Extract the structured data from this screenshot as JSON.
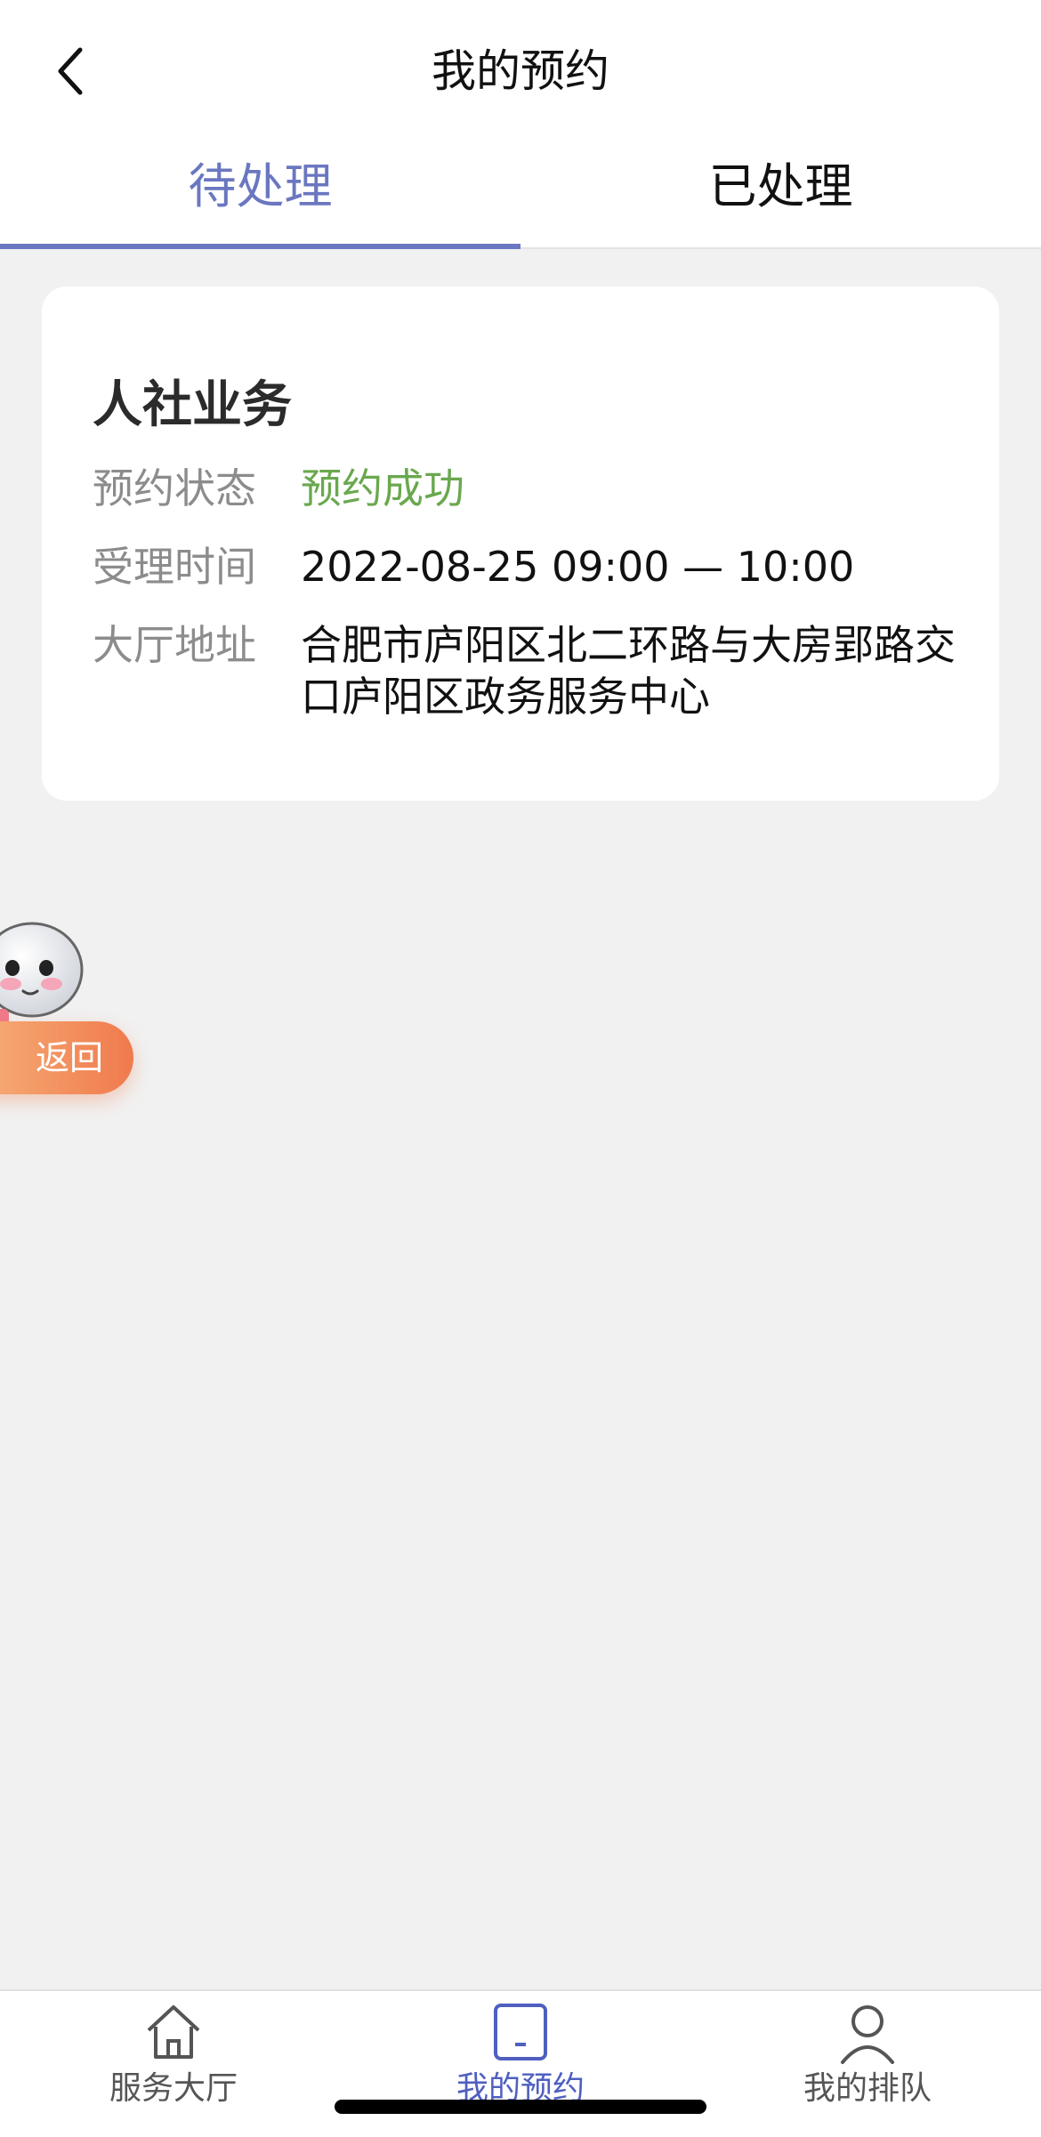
{
  "header": {
    "title": "我的预约",
    "back_icon": "chevron-left-icon"
  },
  "tabs": [
    {
      "label": "待处理",
      "active": true
    },
    {
      "label": "已处理",
      "active": false
    }
  ],
  "card": {
    "title": "人社业务",
    "rows": [
      {
        "label": "预约状态",
        "value": "预约成功"
      },
      {
        "label": "受理时间",
        "value": "2022-08-25 09:00 — 10:00"
      },
      {
        "label": "大厅地址",
        "value": "合肥市庐阳区北二环路与大房郢路交口庐阳区政务服务中心"
      }
    ],
    "status_color": "#6aa84f"
  },
  "floating": {
    "return_label": "返回",
    "mascot_icon": "robot-mascot-icon"
  },
  "bottom_nav": [
    {
      "label": "服务大厅",
      "icon": "home-icon",
      "active": false
    },
    {
      "label": "我的预约",
      "icon": "tablet-icon",
      "active": true
    },
    {
      "label": "我的排队",
      "icon": "user-icon",
      "active": false
    }
  ],
  "colors": {
    "accent": "#6a77c0",
    "nav_active": "#4f5fc0",
    "background": "#f1f1f1"
  }
}
